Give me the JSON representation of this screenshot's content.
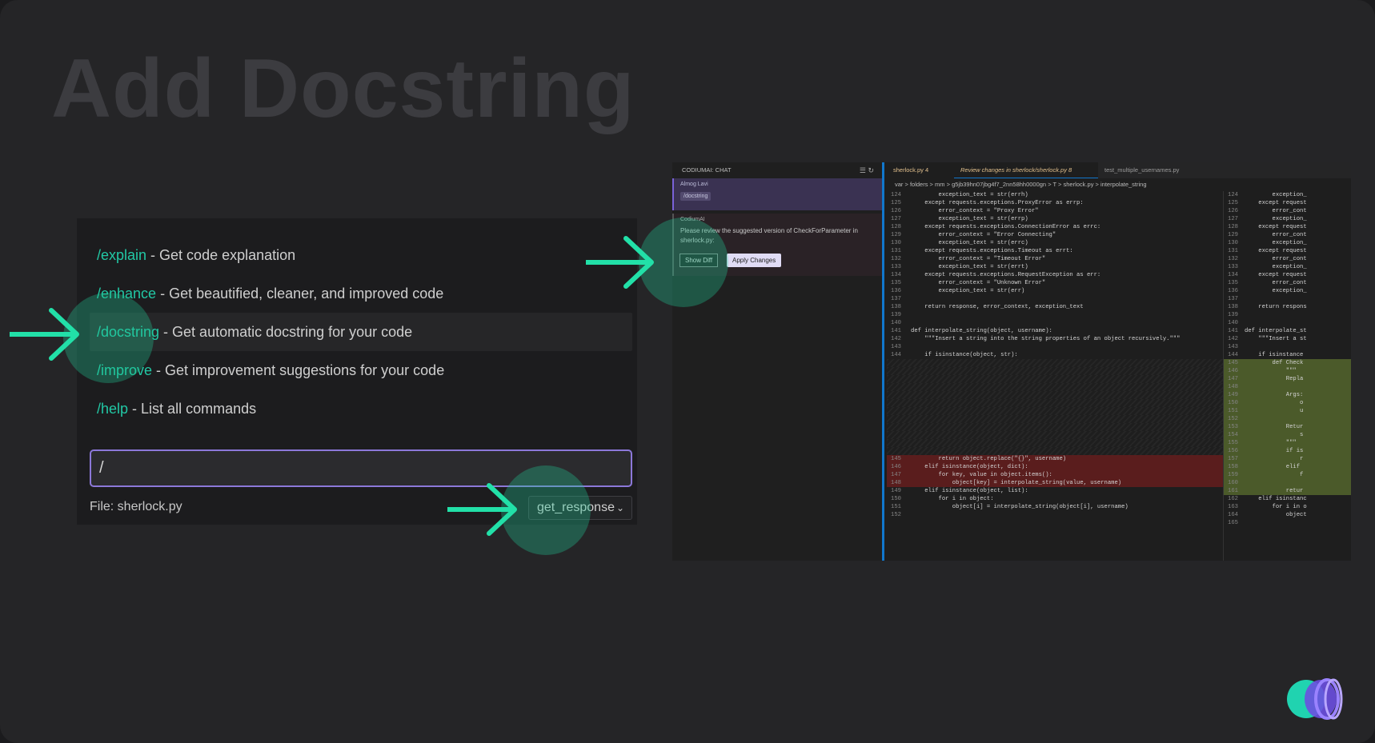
{
  "title": "Add Docstring",
  "commands": [
    {
      "cmd": "/explain",
      "desc": " - Get code explanation"
    },
    {
      "cmd": "/enhance",
      "desc": " - Get beautified, cleaner, and improved code"
    },
    {
      "cmd": "/docstring",
      "desc": " - Get automatic docstring for your code"
    },
    {
      "cmd": "/improve",
      "desc": " - Get improvement suggestions for your code"
    },
    {
      "cmd": "/help",
      "desc": " - List all commands"
    }
  ],
  "input": {
    "value": "/"
  },
  "file": {
    "label": "File: sherlock.py"
  },
  "function_select": {
    "value": "get_response"
  },
  "chat": {
    "header": "CODIUMAI: CHAT",
    "user_name": "Almog Lavi",
    "user_command": "/docstring",
    "ai_name": "CodiumAI",
    "ai_text": "Please review the suggested version of CheckForParameter in sherlock.py:",
    "show_diff": "Show Diff",
    "apply_changes": "Apply Changes"
  },
  "tabs": [
    {
      "label": "sherlock.py 4"
    },
    {
      "label": "Review changes in sherlock/sherlock.py 8"
    },
    {
      "label": "test_multiple_usernames.py"
    }
  ],
  "breadcrumb": "var > folders > mm > g5jb39hn07jbg4f7_2nn58hh0000gn > T > sherlock.py > interpolate_string",
  "code_left": [
    {
      "n": "124",
      "t": "        exception_text = str(errh)"
    },
    {
      "n": "125",
      "t": "    except requests.exceptions.ProxyError as errp:"
    },
    {
      "n": "126",
      "t": "        error_context = \"Proxy Error\""
    },
    {
      "n": "127",
      "t": "        exception_text = str(errp)"
    },
    {
      "n": "128",
      "t": "    except requests.exceptions.ConnectionError as errc:"
    },
    {
      "n": "129",
      "t": "        error_context = \"Error Connecting\""
    },
    {
      "n": "130",
      "t": "        exception_text = str(errc)"
    },
    {
      "n": "131",
      "t": "    except requests.exceptions.Timeout as errt:"
    },
    {
      "n": "132",
      "t": "        error_context = \"Timeout Error\""
    },
    {
      "n": "133",
      "t": "        exception_text = str(errt)"
    },
    {
      "n": "134",
      "t": "    except requests.exceptions.RequestException as err:"
    },
    {
      "n": "135",
      "t": "        error_context = \"Unknown Error\""
    },
    {
      "n": "136",
      "t": "        exception_text = str(err)"
    },
    {
      "n": "137",
      "t": ""
    },
    {
      "n": "138",
      "t": "    return response, error_context, exception_text"
    },
    {
      "n": "139",
      "t": ""
    },
    {
      "n": "140",
      "t": ""
    },
    {
      "n": "141",
      "t": "def interpolate_string(object, username):"
    },
    {
      "n": "142",
      "t": "    \"\"\"Insert a string into the string properties of an object recursively.\"\"\""
    },
    {
      "n": "143",
      "t": ""
    },
    {
      "n": "144",
      "t": "    if isinstance(object, str):"
    }
  ],
  "code_left_del": [
    {
      "n": "145",
      "t": "        return object.replace(\"{}\", username)"
    },
    {
      "n": "146",
      "t": "    elif isinstance(object, dict):"
    },
    {
      "n": "147",
      "t": "        for key, value in object.items():"
    },
    {
      "n": "148",
      "t": "            object[key] = interpolate_string(value, username)"
    }
  ],
  "code_left_tail": [
    {
      "n": "149",
      "t": "    elif isinstance(object, list):"
    },
    {
      "n": "150",
      "t": "        for i in object:"
    },
    {
      "n": "151",
      "t": "            object[i] = interpolate_string(object[i], username)"
    },
    {
      "n": "152",
      "t": ""
    }
  ],
  "code_right": [
    {
      "n": "124",
      "t": "        exception_"
    },
    {
      "n": "125",
      "t": "    except request"
    },
    {
      "n": "126",
      "t": "        error_cont"
    },
    {
      "n": "127",
      "t": "        exception_"
    },
    {
      "n": "128",
      "t": "    except request"
    },
    {
      "n": "129",
      "t": "        error_cont"
    },
    {
      "n": "130",
      "t": "        exception_"
    },
    {
      "n": "131",
      "t": "    except request"
    },
    {
      "n": "132",
      "t": "        error_cont"
    },
    {
      "n": "133",
      "t": "        exception_"
    },
    {
      "n": "134",
      "t": "    except request"
    },
    {
      "n": "135",
      "t": "        error_cont"
    },
    {
      "n": "136",
      "t": "        exception_"
    },
    {
      "n": "137",
      "t": ""
    },
    {
      "n": "138",
      "t": "    return respons"
    },
    {
      "n": "139",
      "t": ""
    },
    {
      "n": "140",
      "t": ""
    },
    {
      "n": "141",
      "t": "def interpolate_st"
    },
    {
      "n": "142",
      "t": "    \"\"\"Insert a st"
    },
    {
      "n": "143",
      "t": ""
    },
    {
      "n": "144",
      "t": "    if isinstance"
    }
  ],
  "code_right_add": [
    {
      "n": "145",
      "t": "        def Check"
    },
    {
      "n": "146",
      "t": "            \"\"\""
    },
    {
      "n": "147",
      "t": "            Repla"
    },
    {
      "n": "148",
      "t": ""
    },
    {
      "n": "149",
      "t": "            Args:"
    },
    {
      "n": "150",
      "t": "                o"
    },
    {
      "n": "151",
      "t": "                u"
    },
    {
      "n": "152",
      "t": ""
    },
    {
      "n": "153",
      "t": "            Retur"
    },
    {
      "n": "154",
      "t": "                s"
    },
    {
      "n": "155",
      "t": "            \"\"\""
    },
    {
      "n": "156",
      "t": "            if is"
    },
    {
      "n": "157",
      "t": "                r"
    },
    {
      "n": "158",
      "t": "            elif "
    },
    {
      "n": "159",
      "t": "                f"
    },
    {
      "n": "160",
      "t": ""
    },
    {
      "n": "161",
      "t": "            retur"
    }
  ],
  "code_right_tail": [
    {
      "n": "162",
      "t": "    elif isinstanc"
    },
    {
      "n": "163",
      "t": "        for i in o"
    },
    {
      "n": "164",
      "t": "            object"
    },
    {
      "n": "165",
      "t": ""
    }
  ],
  "colors": {
    "accent": "#22c8a5",
    "input_border": "#8c78d9",
    "highlight": "rgba(34,200,150,0.33)"
  }
}
